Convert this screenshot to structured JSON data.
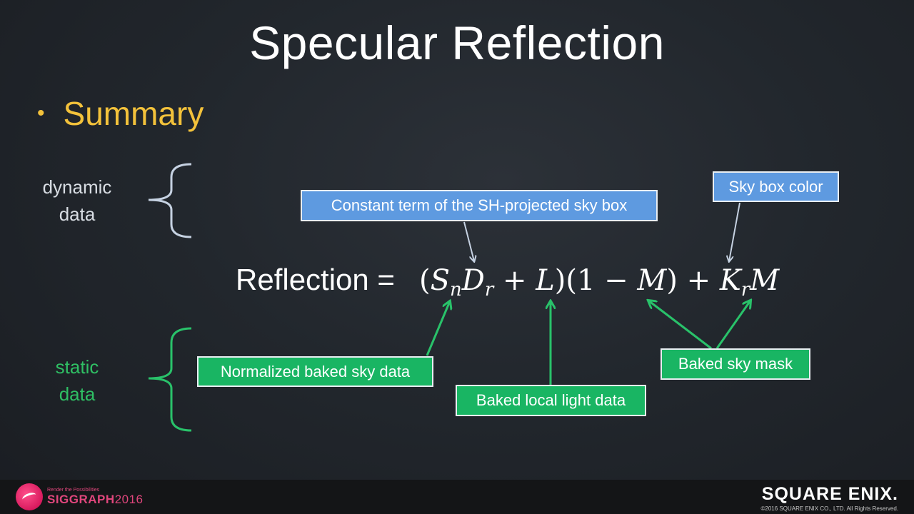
{
  "slide": {
    "title": "Specular Reflection",
    "bullet": "Summary"
  },
  "labels": {
    "dynamic": [
      "dynamic",
      "data"
    ],
    "static": [
      "static",
      "data"
    ]
  },
  "equation": {
    "lhs": "Reflection =",
    "rhs": {
      "open": "(",
      "S": "S",
      "S_sub": "n",
      "D": "D",
      "D_sub": "r",
      "plus1": " + ",
      "L": "L",
      "close_open": ")(1 − ",
      "M1": "M",
      "close_plus": ") + ",
      "K": "K",
      "K_sub": "r",
      "M2": "M"
    }
  },
  "callouts": {
    "sh_constant": "Constant term of the SH-projected sky box",
    "sky_box_color": "Sky box color",
    "normalized_sky": "Normalized baked sky data",
    "local_light": "Baked local light data",
    "sky_mask": "Baked sky mask"
  },
  "colors": {
    "title": "#ffffff",
    "bullet": "#f3c23b",
    "dynamic": "#d8dde3",
    "static": "#2fbf64",
    "callout_blue": "#5e9ae0",
    "callout_green": "#19b563",
    "arrow_blue": "#c6d2e2",
    "arrow_green": "#29c26a"
  },
  "footer": {
    "siggraph_tagline": "Render the Possibilities",
    "siggraph_name": "SIGGRAPH",
    "siggraph_year": "2016",
    "sqex_name": "SQUARE ENIX.",
    "copyright": "©2016 SQUARE ENIX CO., LTD. All Rights Reserved."
  }
}
